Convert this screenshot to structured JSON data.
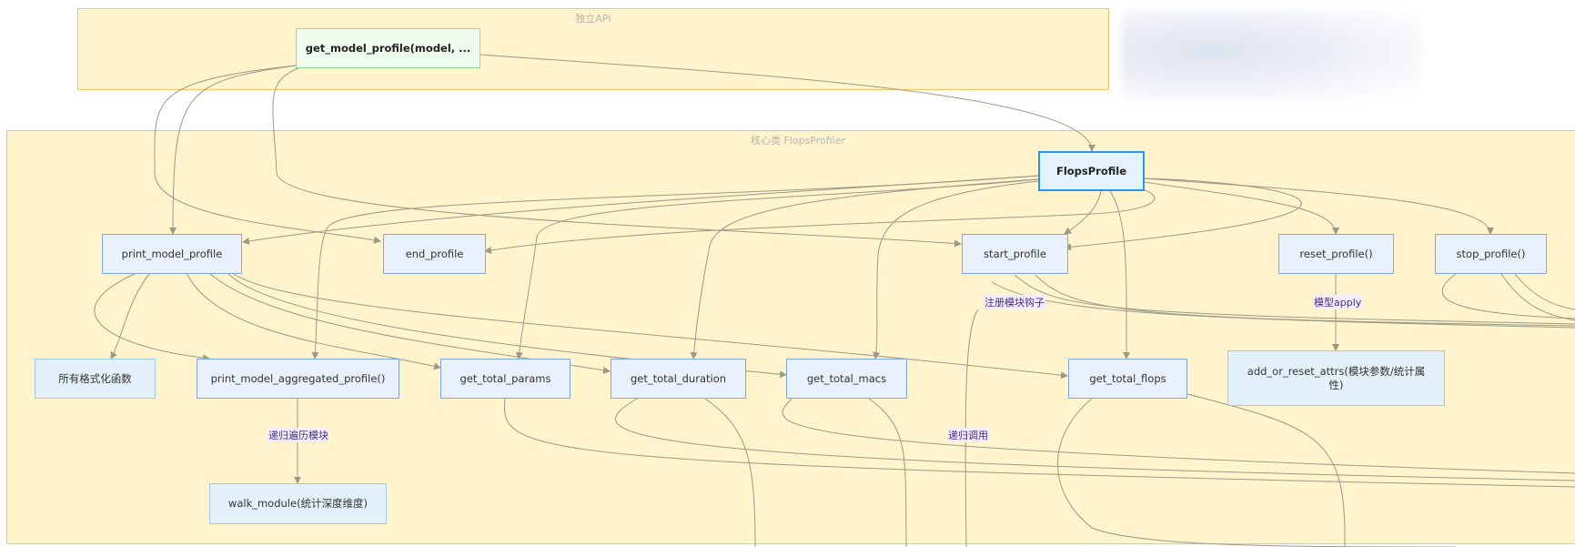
{
  "clusters": {
    "api": {
      "title": "独立API"
    },
    "core": {
      "title": "核心类 FlopsProfiler"
    }
  },
  "nodes": {
    "get_model_profile": "get_model_profile(model, ...",
    "flops_profile": "FlopsProfile",
    "print_model_profile": "print_model_profile",
    "end_profile": "end_profile",
    "start_profile": "start_profile",
    "reset_profile": "reset_profile()",
    "stop_profile": "stop_profile()",
    "format_funcs": "所有格式化函数",
    "print_model_aggregated_profile": "print_model_aggregated_profile()",
    "get_total_params": "get_total_params",
    "get_total_duration": "get_total_duration",
    "get_total_macs": "get_total_macs",
    "get_total_flops": "get_total_flops",
    "add_or_reset_attrs": "add_or_reset_attrs(模块参数/统计属性)",
    "walk_module": "walk_module(统计深度维度)"
  },
  "edge_labels": {
    "register_hooks": "注册模块钩子",
    "model_apply": "模型apply",
    "recursive_walk": "递归遍历模块",
    "recursive_call": "递归调用"
  },
  "colors": {
    "cluster_fill": "#fff4cc",
    "cluster_border": "#f2c76a",
    "node_fill": "#e8f1fc",
    "node_border": "#7fa6e6",
    "main_border": "#2196f3",
    "green_fill": "#eefcee",
    "edge": "#9a9a86"
  }
}
